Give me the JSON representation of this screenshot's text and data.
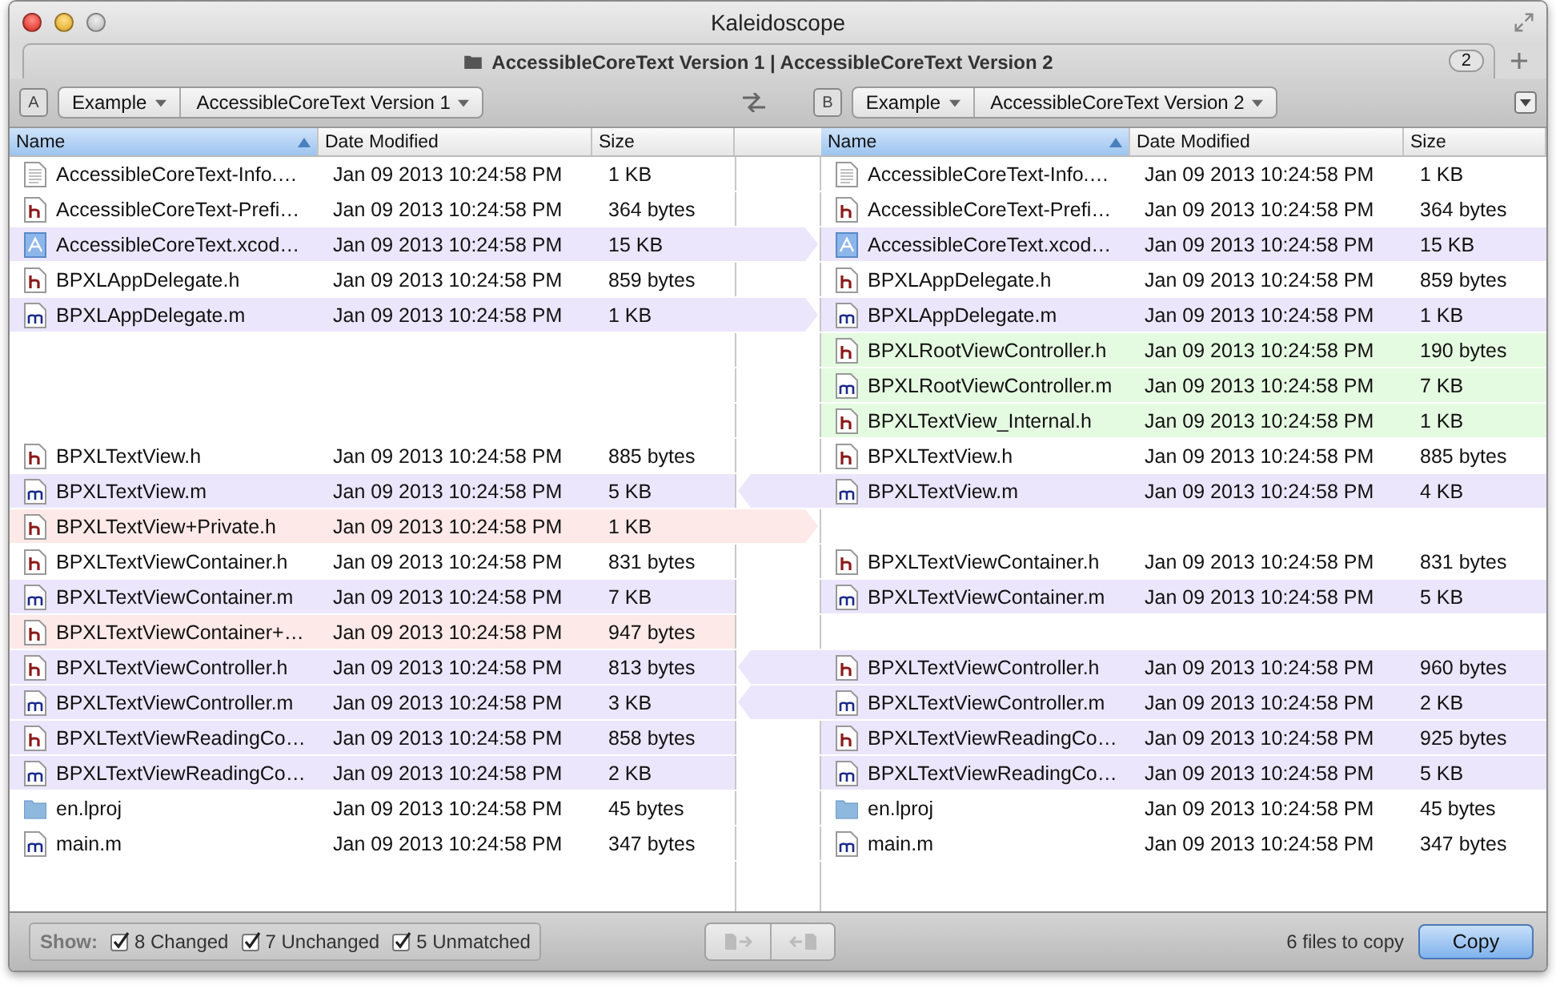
{
  "window": {
    "title": "Kaleidoscope"
  },
  "tab": {
    "title": "AccessibleCoreText Version 1 | AccessibleCoreText Version 2",
    "count": "2"
  },
  "panes": [
    {
      "badge": "A",
      "path": [
        "Example",
        "AccessibleCoreText Version 1"
      ],
      "columns": [
        {
          "label": "Name",
          "selected": true
        },
        {
          "label": "Date Modified",
          "selected": false
        },
        {
          "label": "Size",
          "selected": false
        }
      ]
    },
    {
      "badge": "B",
      "path": [
        "Example",
        "AccessibleCoreText Version 2"
      ],
      "columns": [
        {
          "label": "Name",
          "selected": true
        },
        {
          "label": "Date Modified",
          "selected": false
        },
        {
          "label": "Size",
          "selected": false
        }
      ]
    }
  ],
  "rows": [
    {
      "kind": "plain",
      "left": {
        "kind": "plist",
        "name": "AccessibleCoreText-Info.…",
        "date": "Jan 09 2013 10:24:58 PM",
        "size": "1 KB"
      },
      "right": {
        "kind": "plist",
        "name": "AccessibleCoreText-Info.…",
        "date": "Jan 09 2013 10:24:58 PM",
        "size": "1 KB"
      }
    },
    {
      "kind": "plain",
      "left": {
        "kind": "h",
        "name": "AccessibleCoreText-Prefi…",
        "date": "Jan 09 2013 10:24:58 PM",
        "size": "364 bytes"
      },
      "right": {
        "kind": "h",
        "name": "AccessibleCoreText-Prefi…",
        "date": "Jan 09 2013 10:24:58 PM",
        "size": "364 bytes"
      }
    },
    {
      "kind": "copy_right",
      "color": "#ebe6fb",
      "left": {
        "kind": "xcodeproj",
        "name": "AccessibleCoreText.xcod…",
        "date": "Jan 09 2013 10:24:58 PM",
        "size": "15 KB"
      },
      "right": {
        "kind": "xcodeproj",
        "name": "AccessibleCoreText.xcod…",
        "date": "Jan 09 2013 10:24:58 PM",
        "size": "15 KB"
      }
    },
    {
      "kind": "plain",
      "left": {
        "kind": "h",
        "name": "BPXLAppDelegate.h",
        "date": "Jan 09 2013 10:24:58 PM",
        "size": "859 bytes"
      },
      "right": {
        "kind": "h",
        "name": "BPXLAppDelegate.h",
        "date": "Jan 09 2013 10:24:58 PM",
        "size": "859 bytes"
      }
    },
    {
      "kind": "copy_right",
      "color": "#ebe6fb",
      "left": {
        "kind": "m",
        "name": "BPXLAppDelegate.m",
        "date": "Jan 09 2013 10:24:58 PM",
        "size": "1 KB"
      },
      "right": {
        "kind": "m",
        "name": "BPXLAppDelegate.m",
        "date": "Jan 09 2013 10:24:58 PM",
        "size": "1 KB"
      }
    },
    {
      "kind": "plain",
      "color": "#e5fbe1",
      "right": {
        "kind": "h",
        "name": "BPXLRootViewController.h",
        "date": "Jan 09 2013 10:24:58 PM",
        "size": "190 bytes"
      }
    },
    {
      "kind": "plain",
      "color": "#e5fbe1",
      "right": {
        "kind": "m",
        "name": "BPXLRootViewController.m",
        "date": "Jan 09 2013 10:24:58 PM",
        "size": "7 KB"
      }
    },
    {
      "kind": "plain",
      "color": "#e5fbe1",
      "right": {
        "kind": "h",
        "name": "BPXLTextView_Internal.h",
        "date": "Jan 09 2013 10:24:58 PM",
        "size": "1 KB"
      }
    },
    {
      "kind": "plain",
      "left": {
        "kind": "h",
        "name": "BPXLTextView.h",
        "date": "Jan 09 2013 10:24:58 PM",
        "size": "885 bytes"
      },
      "right": {
        "kind": "h",
        "name": "BPXLTextView.h",
        "date": "Jan 09 2013 10:24:58 PM",
        "size": "885 bytes"
      }
    },
    {
      "kind": "copy_left",
      "color": "#ebe6fb",
      "left": {
        "kind": "m",
        "name": "BPXLTextView.m",
        "date": "Jan 09 2013 10:24:58 PM",
        "size": "5 KB"
      },
      "right": {
        "kind": "m",
        "name": "BPXLTextView.m",
        "date": "Jan 09 2013 10:24:58 PM",
        "size": "4 KB"
      }
    },
    {
      "kind": "copy_right",
      "color": "#fde9e7",
      "left": {
        "kind": "h",
        "name": "BPXLTextView+Private.h",
        "date": "Jan 09 2013 10:24:58 PM",
        "size": "1 KB"
      }
    },
    {
      "kind": "plain",
      "left": {
        "kind": "h",
        "name": "BPXLTextViewContainer.h",
        "date": "Jan 09 2013 10:24:58 PM",
        "size": "831 bytes"
      },
      "right": {
        "kind": "h",
        "name": "BPXLTextViewContainer.h",
        "date": "Jan 09 2013 10:24:58 PM",
        "size": "831 bytes"
      }
    },
    {
      "kind": "plain",
      "color": "#ebe6fb",
      "left": {
        "kind": "m",
        "name": "BPXLTextViewContainer.m",
        "date": "Jan 09 2013 10:24:58 PM",
        "size": "7 KB"
      },
      "right": {
        "kind": "m",
        "name": "BPXLTextViewContainer.m",
        "date": "Jan 09 2013 10:24:58 PM",
        "size": "5 KB"
      }
    },
    {
      "kind": "plain",
      "color": "#fde9e7",
      "left": {
        "kind": "h",
        "name": "BPXLTextViewContainer+…",
        "date": "Jan 09 2013 10:24:58 PM",
        "size": "947 bytes"
      }
    },
    {
      "kind": "copy_left",
      "color": "#ebe6fb",
      "left": {
        "kind": "h",
        "name": "BPXLTextViewController.h",
        "date": "Jan 09 2013 10:24:58 PM",
        "size": "813 bytes"
      },
      "right": {
        "kind": "h",
        "name": "BPXLTextViewController.h",
        "date": "Jan 09 2013 10:24:58 PM",
        "size": "960 bytes"
      }
    },
    {
      "kind": "copy_left",
      "color": "#ebe6fb",
      "left": {
        "kind": "m",
        "name": "BPXLTextViewController.m",
        "date": "Jan 09 2013 10:24:58 PM",
        "size": "3 KB"
      },
      "right": {
        "kind": "m",
        "name": "BPXLTextViewController.m",
        "date": "Jan 09 2013 10:24:58 PM",
        "size": "2 KB"
      }
    },
    {
      "kind": "plain",
      "color": "#ebe6fb",
      "left": {
        "kind": "h",
        "name": "BPXLTextViewReadingCo…",
        "date": "Jan 09 2013 10:24:58 PM",
        "size": "858 bytes"
      },
      "right": {
        "kind": "h",
        "name": "BPXLTextViewReadingCo…",
        "date": "Jan 09 2013 10:24:58 PM",
        "size": "925 bytes"
      }
    },
    {
      "kind": "plain",
      "color": "#ebe6fb",
      "left": {
        "kind": "m",
        "name": "BPXLTextViewReadingCo…",
        "date": "Jan 09 2013 10:24:58 PM",
        "size": "2 KB"
      },
      "right": {
        "kind": "m",
        "name": "BPXLTextViewReadingCo…",
        "date": "Jan 09 2013 10:24:58 PM",
        "size": "5 KB"
      }
    },
    {
      "kind": "plain",
      "left": {
        "kind": "folder",
        "name": "en.lproj",
        "date": "Jan 09 2013 10:24:58 PM",
        "size": "45 bytes"
      },
      "right": {
        "kind": "folder",
        "name": "en.lproj",
        "date": "Jan 09 2013 10:24:58 PM",
        "size": "45 bytes"
      }
    },
    {
      "kind": "plain",
      "left": {
        "kind": "m",
        "name": "main.m",
        "date": "Jan 09 2013 10:24:58 PM",
        "size": "347 bytes"
      },
      "right": {
        "kind": "m",
        "name": "main.m",
        "date": "Jan 09 2013 10:24:58 PM",
        "size": "347 bytes"
      }
    }
  ],
  "footer": {
    "show_label": "Show:",
    "filters": [
      {
        "label": "8 Changed",
        "checked": true
      },
      {
        "label": "7 Unchanged",
        "checked": true
      },
      {
        "label": "5 Unmatched",
        "checked": true
      }
    ],
    "copy_status": "6 files to copy",
    "copy_button": "Copy"
  }
}
